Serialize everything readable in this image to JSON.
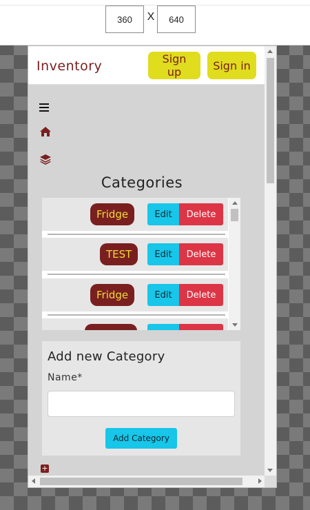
{
  "emulator": {
    "width_value": "360",
    "separator": "X",
    "height_value": "640"
  },
  "navbar": {
    "brand": "Inventory",
    "signup_label": "Sign up",
    "signin_label": "Sign in"
  },
  "sidebar": {
    "icons": [
      "menu-icon",
      "home-icon",
      "layers-icon"
    ]
  },
  "categories": {
    "title": "Categories",
    "edit_label": "Edit",
    "delete_label": "Delete",
    "items": [
      {
        "name": "Fridge"
      },
      {
        "name": "TEST"
      },
      {
        "name": "Fridge"
      }
    ]
  },
  "add_form": {
    "title": "Add new Category",
    "name_label": "Name*",
    "name_value": "",
    "submit_label": "Add Category"
  },
  "colors": {
    "brand": "#7a1f1f",
    "nav_button": "#e0dc1e",
    "badge_text": "#eedc3a",
    "edit": "#17c6e8",
    "delete": "#dc3545"
  }
}
